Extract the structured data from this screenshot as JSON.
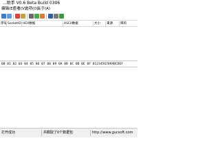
{
  "window": {
    "title": "...助手 V0.6 Beta Build 0306"
  },
  "menu": [
    "编辑(E)",
    "查看(V)",
    "选项(O)",
    "关于(A)"
  ],
  "toolbar": {
    "buttons": [
      {
        "icon": "back-icon",
        "color": "#3b7bd4"
      },
      {
        "icon": "forward-icon",
        "color": "#5aa0e0"
      },
      {
        "icon": "start-capture-icon",
        "color": "#e04040"
      },
      {
        "icon": "pause-icon",
        "color": "#c8a040"
      },
      {
        "icon": "clear-icon",
        "color": "#6a6a6a"
      },
      {
        "icon": "grid-icon",
        "color": "#4aa84a"
      },
      {
        "icon": "filter-icon",
        "color": "#d97a2e"
      },
      {
        "icon": "find-icon",
        "color": "#2f5fa8"
      },
      {
        "icon": "settings-icon",
        "color": "#7a7a7a"
      },
      {
        "icon": "refresh-icon",
        "color": "#3c9a3c"
      }
    ]
  },
  "table": {
    "columns": [
      "序号",
      "SocketID",
      "HEX数据",
      "ASCII数据",
      "大小",
      "来源",
      "目的"
    ]
  },
  "hex_header": "00 01 02 03 04 05 06 07 08 09 0A 0B 0C 0D 0E 0F  0123456789ABCDEF",
  "status": {
    "left": "打开成功",
    "middle": "共截取了0个数据包",
    "right": "http://www.gucsoft.com"
  }
}
